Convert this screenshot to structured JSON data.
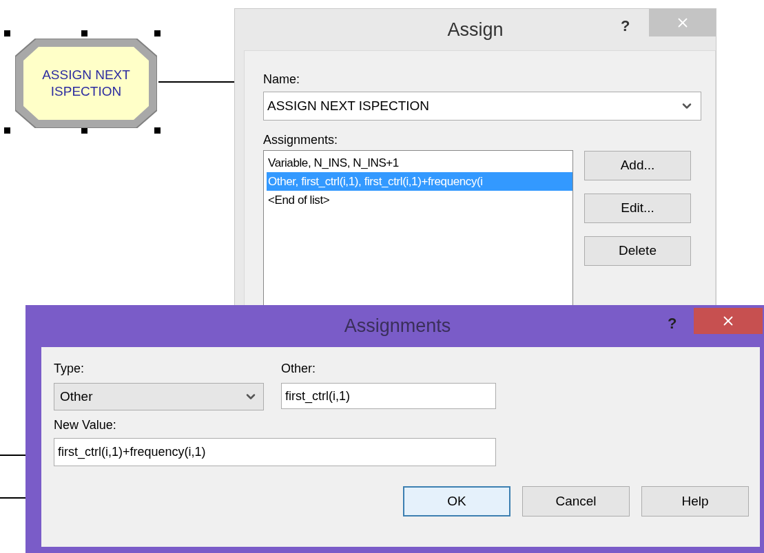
{
  "module": {
    "label": "ASSIGN NEXT ISPECTION",
    "selected": true
  },
  "assign_dialog": {
    "title": "Assign",
    "help": "?",
    "name_label": "Name:",
    "name_value": "ASSIGN NEXT ISPECTION",
    "assignments_label": "Assignments:",
    "assignments": [
      {
        "text": "Variable, N_INS, N_INS+1",
        "selected": false
      },
      {
        "text": "Other, first_ctrl(i,1), first_ctrl(i,1)+frequency(i",
        "selected": true
      },
      {
        "text": "<End of list>",
        "selected": false
      }
    ],
    "buttons": [
      "Add...",
      "Edit...",
      "Delete"
    ]
  },
  "assignments_dialog": {
    "title": "Assignments",
    "help": "?",
    "type_label": "Type:",
    "type_value": "Other",
    "other_label": "Other:",
    "other_value": "first_ctrl(i,1)",
    "new_value_label": "New Value:",
    "new_value": "first_ctrl(i,1)+frequency(i,1)",
    "buttons": [
      {
        "label": "OK",
        "default": true
      },
      {
        "label": "Cancel",
        "default": false
      },
      {
        "label": "Help",
        "default": false
      }
    ]
  }
}
